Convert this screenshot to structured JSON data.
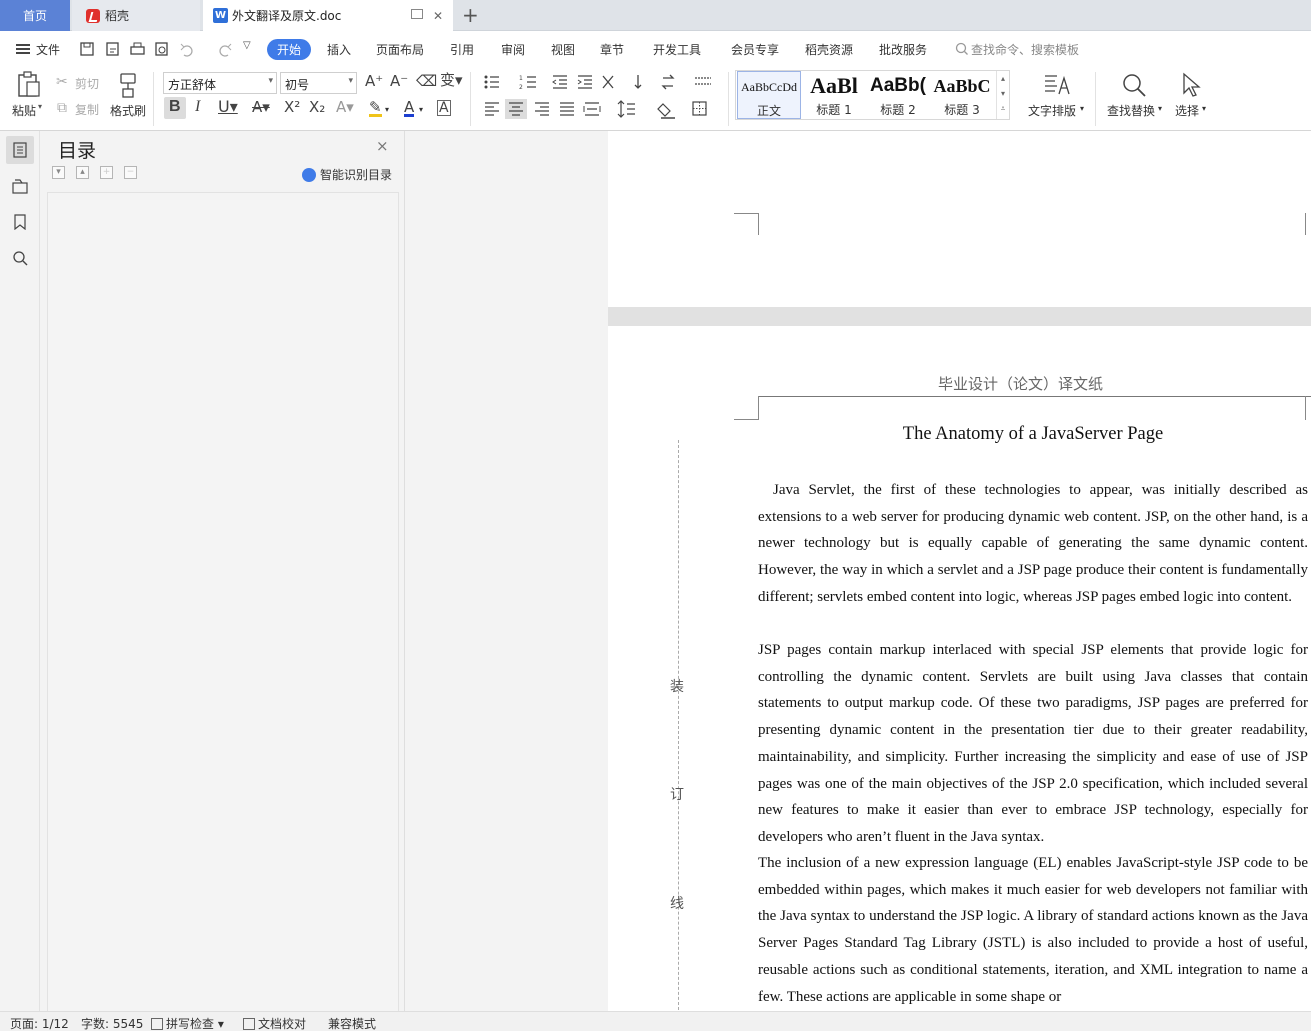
{
  "tabs": {
    "home": "首页",
    "daoke": "稻壳",
    "document": "外文翻译及原文.doc",
    "add": "+"
  },
  "menu": {
    "file": "文件",
    "items": [
      "开始",
      "插入",
      "页面布局",
      "引用",
      "审阅",
      "视图",
      "章节",
      "开发工具",
      "会员专享",
      "稻壳资源",
      "批改服务"
    ],
    "search_placeholder": "查找命令、搜索模板"
  },
  "ribbon": {
    "paste": "粘贴",
    "cut": "剪切",
    "copy": "复制",
    "format_painter": "格式刷",
    "font_name": "方正舒体",
    "font_size": "初号",
    "styles": [
      {
        "sample": "AaBbCcDd",
        "name": "正文"
      },
      {
        "sample": "AaBl",
        "name": "标题 1"
      },
      {
        "sample": "AaBb(",
        "name": "标题 2"
      },
      {
        "sample": "AaBbC",
        "name": "标题 3"
      }
    ],
    "text_layout": "文字排版",
    "find_replace": "查找替换",
    "select": "选择"
  },
  "toc": {
    "title": "目录",
    "close": "×",
    "ai_label": "智能识别目录"
  },
  "document": {
    "header": "毕业设计（论文）译文纸",
    "title": "The Anatomy of a JavaServer Page",
    "paragraphs": [
      "Java Servlet, the first of these technologies to appear, was initially described as extensions to a web server for producing dynamic web content. JSP, on the other hand, is a newer technology but is equally capable of generating the same dynamic content. However, the way in which a servlet and a JSP page produce their content is fundamentally different; servlets embed content into logic, whereas JSP pages embed logic into content.",
      "JSP pages contain markup interlaced with special JSP elements that provide logic for controlling the dynamic content. Servlets are built using Java classes that contain statements to output markup code. Of these two paradigms, JSP pages are preferred for presenting dynamic content in the presentation tier due to their greater readability, maintainability, and simplicity. Further increasing the simplicity and ease of use of JSP pages was one of the main objectives of the JSP 2.0 specification, which included several new features to make it easier than ever to embrace JSP technology, especially for developers who aren’t fluent in the Java syntax.",
      "The inclusion of a new expression language (EL) enables JavaScript-style JSP code to be embedded within pages, which makes it much easier for web developers not familiar with the Java syntax to understand the JSP logic. A library of standard actions known as the Java Server Pages Standard Tag Library (JSTL) is also included to provide a host of useful, reusable actions such as conditional statements, iteration, and XML integration to name a few. These actions are applicable in some shape or"
    ],
    "binding": [
      "装",
      "订",
      "线"
    ]
  },
  "status": {
    "page": "页面: 1/12",
    "words": "字数: 5545",
    "spell": "拼写检查",
    "proof": "文档校对",
    "compat": "兼容模式"
  },
  "colors": {
    "accent": "#3f7be8",
    "home_tab": "#5b82d6",
    "font_color_underline": "#1c3fd0",
    "highlight_underline": "#f0c419"
  }
}
